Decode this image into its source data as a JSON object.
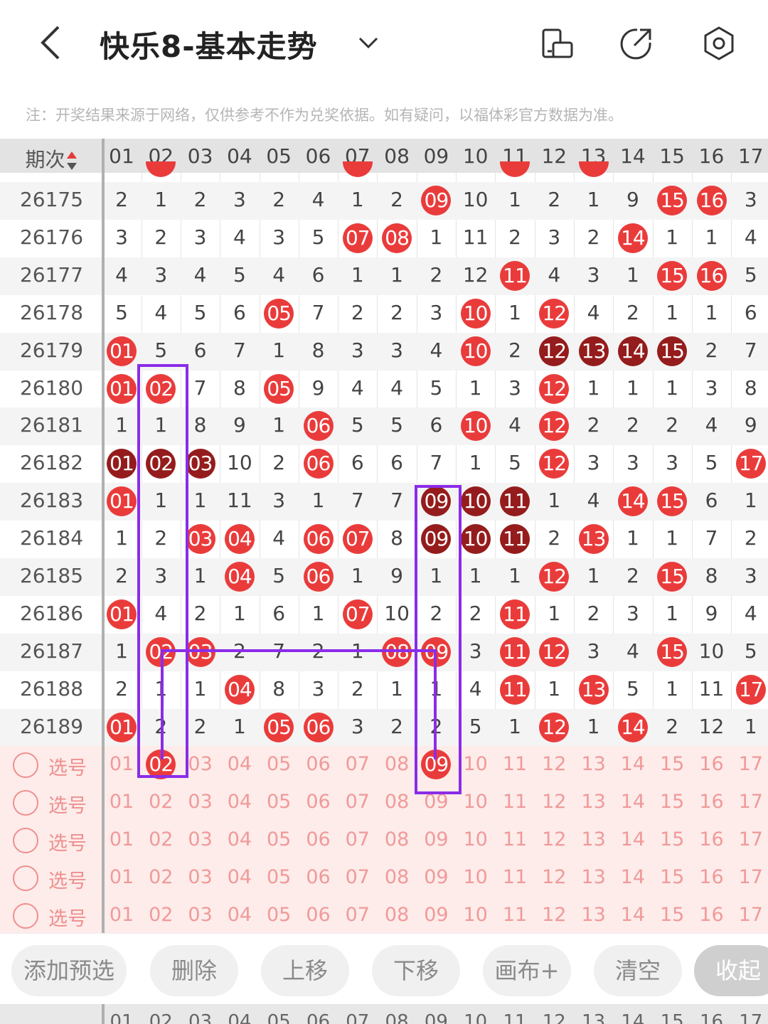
{
  "header": {
    "title": "快乐8-基本走势"
  },
  "note": "注：开奖结果来源于网络，仅供参考不作为兑奖依据。如有疑问，以福体彩官方数据为准。",
  "table": {
    "period_header": "期次",
    "sort_icon": "sort-updown-icon",
    "columns": [
      "01",
      "02",
      "03",
      "04",
      "05",
      "06",
      "07",
      "08",
      "09",
      "10",
      "11",
      "12",
      "13",
      "14",
      "15",
      "16",
      "17"
    ],
    "top_partial_balls": [
      "02",
      "07",
      "11",
      "13"
    ],
    "rows": [
      {
        "period": "26175",
        "cells": [
          "2",
          "1",
          "2",
          "3",
          "2",
          "4",
          "1",
          "2",
          "09",
          "10",
          "1",
          "2",
          "1",
          "9",
          "15",
          "16",
          "3"
        ],
        "balls": [
          9,
          15,
          16
        ],
        "dark": []
      },
      {
        "period": "26176",
        "cells": [
          "3",
          "2",
          "3",
          "4",
          "3",
          "5",
          "07",
          "08",
          "1",
          "11",
          "2",
          "3",
          "2",
          "14",
          "1",
          "1",
          "4"
        ],
        "balls": [
          7,
          8,
          14
        ],
        "dark": []
      },
      {
        "period": "26177",
        "cells": [
          "4",
          "3",
          "4",
          "5",
          "4",
          "6",
          "1",
          "1",
          "2",
          "12",
          "11",
          "4",
          "3",
          "1",
          "15",
          "16",
          "5"
        ],
        "balls": [
          11,
          15,
          16
        ],
        "dark": []
      },
      {
        "period": "26178",
        "cells": [
          "5",
          "4",
          "5",
          "6",
          "05",
          "7",
          "2",
          "2",
          "3",
          "10",
          "1",
          "12",
          "4",
          "2",
          "1",
          "1",
          "6"
        ],
        "balls": [
          5,
          10,
          12
        ],
        "dark": []
      },
      {
        "period": "26179",
        "cells": [
          "01",
          "5",
          "6",
          "7",
          "1",
          "8",
          "3",
          "3",
          "4",
          "10",
          "2",
          "12",
          "13",
          "14",
          "15",
          "2",
          "7"
        ],
        "balls": [
          1,
          10,
          12,
          13,
          14,
          15
        ],
        "dark": [
          12,
          13,
          14,
          15
        ]
      },
      {
        "period": "26180",
        "cells": [
          "01",
          "02",
          "7",
          "8",
          "05",
          "9",
          "4",
          "4",
          "5",
          "1",
          "3",
          "12",
          "1",
          "1",
          "1",
          "3",
          "8"
        ],
        "balls": [
          1,
          2,
          5,
          12
        ],
        "dark": []
      },
      {
        "period": "26181",
        "cells": [
          "1",
          "1",
          "8",
          "9",
          "1",
          "06",
          "5",
          "5",
          "6",
          "10",
          "4",
          "12",
          "2",
          "2",
          "2",
          "4",
          "9"
        ],
        "balls": [
          6,
          10,
          12
        ],
        "dark": []
      },
      {
        "period": "26182",
        "cells": [
          "01",
          "02",
          "03",
          "10",
          "2",
          "06",
          "6",
          "6",
          "7",
          "1",
          "5",
          "12",
          "3",
          "3",
          "3",
          "5",
          "17"
        ],
        "balls": [
          1,
          2,
          3,
          6,
          12,
          17
        ],
        "dark": [
          1,
          2,
          3
        ]
      },
      {
        "period": "26183",
        "cells": [
          "01",
          "1",
          "1",
          "11",
          "3",
          "1",
          "7",
          "7",
          "09",
          "10",
          "11",
          "1",
          "4",
          "14",
          "15",
          "6",
          "1"
        ],
        "balls": [
          1,
          9,
          10,
          11,
          14,
          15
        ],
        "dark": [
          9,
          10,
          11
        ]
      },
      {
        "period": "26184",
        "cells": [
          "1",
          "2",
          "03",
          "04",
          "4",
          "06",
          "07",
          "8",
          "09",
          "10",
          "11",
          "2",
          "13",
          "1",
          "1",
          "7",
          "2"
        ],
        "balls": [
          3,
          4,
          6,
          7,
          9,
          10,
          11,
          13
        ],
        "dark": [
          9,
          10,
          11
        ]
      },
      {
        "period": "26185",
        "cells": [
          "2",
          "3",
          "1",
          "04",
          "5",
          "06",
          "1",
          "9",
          "1",
          "1",
          "1",
          "12",
          "1",
          "2",
          "15",
          "8",
          "3"
        ],
        "balls": [
          4,
          6,
          12,
          15
        ],
        "dark": []
      },
      {
        "period": "26186",
        "cells": [
          "01",
          "4",
          "2",
          "1",
          "6",
          "1",
          "07",
          "10",
          "2",
          "2",
          "11",
          "1",
          "2",
          "3",
          "1",
          "9",
          "4"
        ],
        "balls": [
          1,
          7,
          11
        ],
        "dark": []
      },
      {
        "period": "26187",
        "cells": [
          "1",
          "02",
          "03",
          "2",
          "7",
          "2",
          "1",
          "08",
          "09",
          "3",
          "11",
          "12",
          "3",
          "4",
          "15",
          "10",
          "5"
        ],
        "balls": [
          2,
          3,
          8,
          9,
          11,
          12,
          15
        ],
        "dark": []
      },
      {
        "period": "26188",
        "cells": [
          "2",
          "1",
          "1",
          "04",
          "8",
          "3",
          "2",
          "1",
          "1",
          "4",
          "11",
          "1",
          "13",
          "5",
          "1",
          "11",
          "17"
        ],
        "balls": [
          4,
          11,
          13,
          17
        ],
        "dark": []
      },
      {
        "period": "26189",
        "cells": [
          "01",
          "2",
          "2",
          "1",
          "05",
          "06",
          "3",
          "2",
          "2",
          "5",
          "1",
          "12",
          "1",
          "14",
          "2",
          "12",
          "1"
        ],
        "balls": [
          1,
          5,
          6,
          12,
          14
        ],
        "dark": []
      }
    ]
  },
  "selection": {
    "label": "选号",
    "rows": 5,
    "numbers": [
      "01",
      "02",
      "03",
      "04",
      "05",
      "06",
      "07",
      "08",
      "09",
      "10",
      "11",
      "12",
      "13",
      "14",
      "15",
      "16",
      "17"
    ],
    "selected_first_row": [
      2,
      9
    ]
  },
  "toolbar": {
    "add": "添加预选",
    "delete": "删除",
    "up": "上移",
    "down": "下移",
    "canvas": "画布+",
    "clear": "清空",
    "collapse": "收起"
  },
  "colors": {
    "ball_red": "#ea3b3b",
    "ball_dark": "#951c1c",
    "annotation_purple": "#8b2ce8",
    "selection_bg": "#fdecea"
  }
}
